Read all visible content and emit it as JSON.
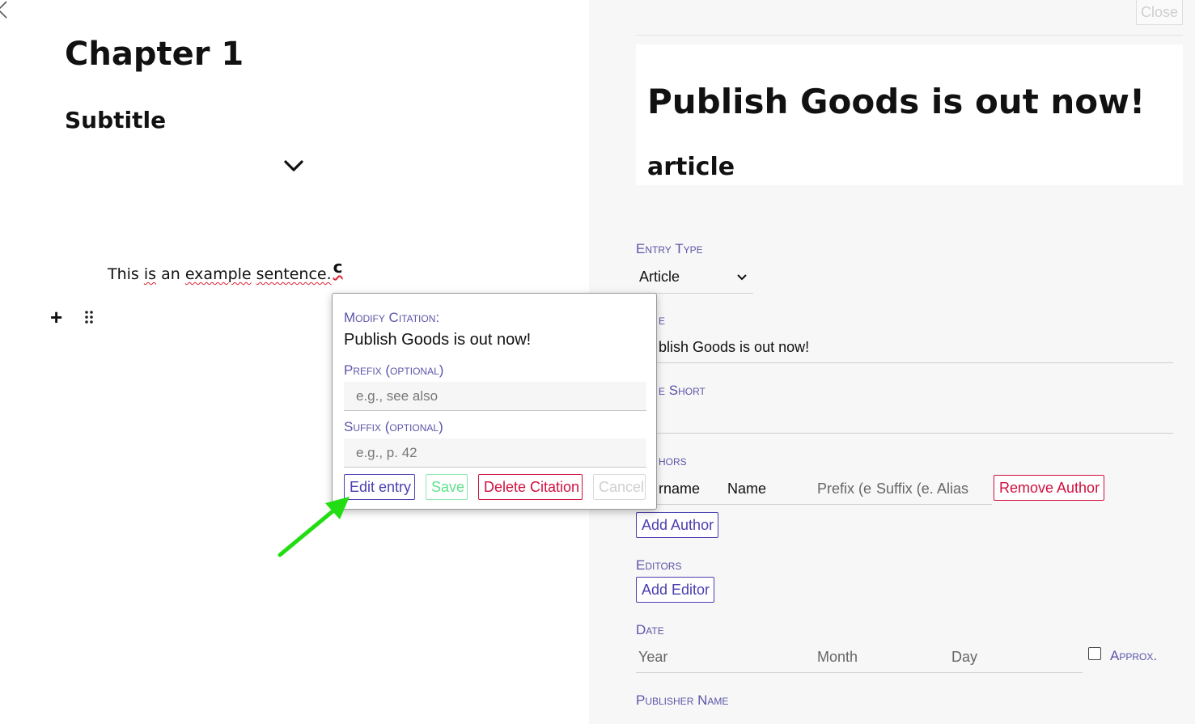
{
  "editor": {
    "chapter_title": "Chapter 1",
    "subtitle": "Subtitle",
    "sentence_parts": [
      "This ",
      "is",
      " an ",
      "example",
      " ",
      "sentence."
    ],
    "citation_marker": "c"
  },
  "popup": {
    "heading": "Modify Citation:",
    "entry_title": "Publish Goods is out now!",
    "prefix_label": "Prefix (optional)",
    "prefix_placeholder": "e.g., see also",
    "suffix_label": "Suffix (optional)",
    "suffix_placeholder": "e.g., p. 42",
    "buttons": {
      "edit": "Edit entry",
      "save": "Save",
      "delete": "Delete Citation",
      "cancel": "Cancel"
    }
  },
  "panel": {
    "close_label": "Close",
    "preview_title": "Publish Goods is out now!",
    "preview_type": "article",
    "entry_type_label": "Entry Type",
    "entry_type_value": "Article",
    "title_label_visible": "e",
    "title_value_visible": "blish Goods is out now!",
    "title_short_label_visible": "e Short",
    "authors_label_visible": "hors",
    "author_fields": {
      "surname_visible": "rname",
      "name": "Name",
      "prefix_placeholder": "Prefix (e",
      "suffix_placeholder": "Suffix (e.",
      "alias_placeholder": "Alias"
    },
    "remove_author": "Remove Author",
    "add_author": "Add Author",
    "editors_label": "Editors",
    "add_editor": "Add Editor",
    "date_label": "Date",
    "date_fields": {
      "year": "Year",
      "month": "Month",
      "day": "Day"
    },
    "approx_label": "Approx.",
    "publisher_label": "Publisher Name"
  },
  "colors": {
    "accent": "#4a3fb0",
    "label": "#5b55a8",
    "danger": "#d0103e",
    "success": "#5ee28e",
    "annotation_arrow": "#22dd11"
  }
}
